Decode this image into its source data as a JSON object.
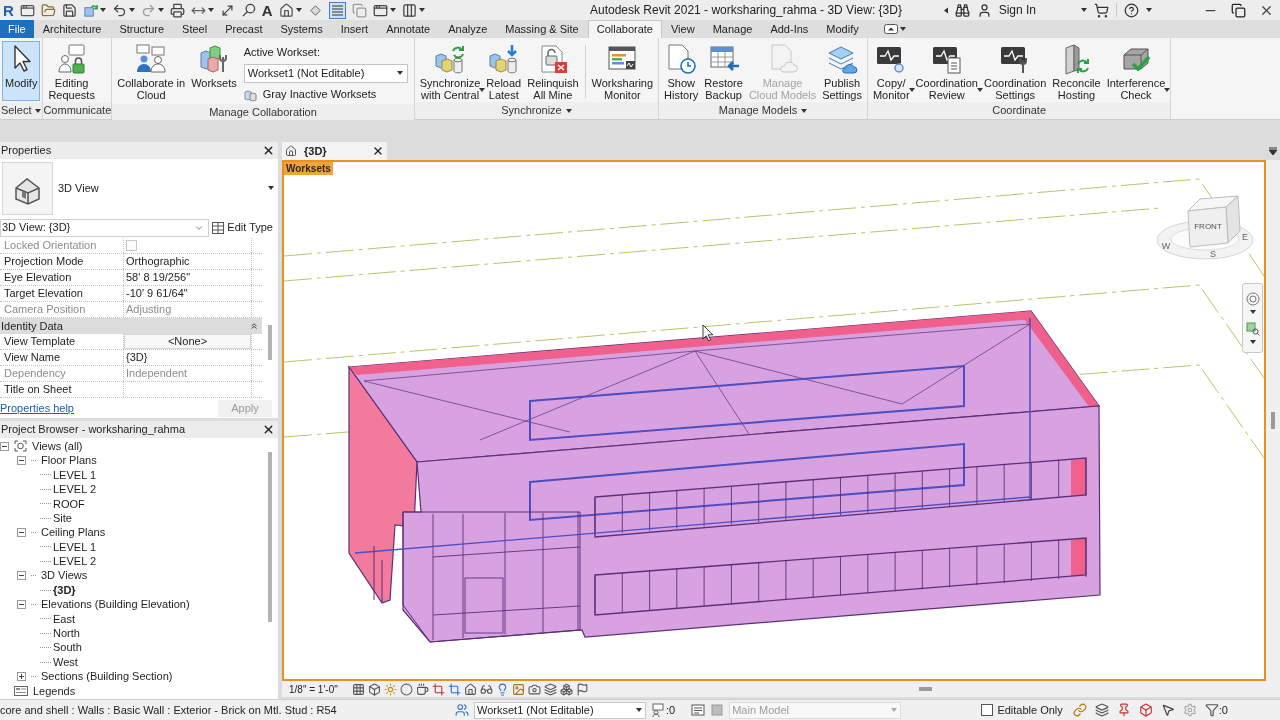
{
  "title_bar": {
    "logo": "R",
    "text_tool": "A",
    "thin_lines_active": true,
    "title": "Autodesk Revit 2021 - worksharing_rahma - 3D View: {3D}",
    "sign_in": "Sign In"
  },
  "ribbon": {
    "tabs": [
      {
        "label": "File",
        "kind": "file",
        "selected": false
      },
      {
        "label": "Architecture",
        "kind": "tab",
        "selected": false
      },
      {
        "label": "Structure",
        "kind": "tab",
        "selected": false
      },
      {
        "label": "Steel",
        "kind": "tab",
        "selected": false
      },
      {
        "label": "Precast",
        "kind": "tab",
        "selected": false
      },
      {
        "label": "Systems",
        "kind": "tab",
        "selected": false
      },
      {
        "label": "Insert",
        "kind": "tab",
        "selected": false
      },
      {
        "label": "Annotate",
        "kind": "tab",
        "selected": false
      },
      {
        "label": "Analyze",
        "kind": "tab",
        "selected": false
      },
      {
        "label": "Massing & Site",
        "kind": "tab",
        "selected": false
      },
      {
        "label": "Collaborate",
        "kind": "tab",
        "selected": true
      },
      {
        "label": "View",
        "kind": "tab",
        "selected": false
      },
      {
        "label": "Manage",
        "kind": "tab",
        "selected": false
      },
      {
        "label": "Add-Ins",
        "kind": "tab",
        "selected": false
      },
      {
        "label": "Modify",
        "kind": "tab",
        "selected": false
      }
    ],
    "panels": [
      {
        "title": "Select",
        "menu": true,
        "groups": [
          [
            {
              "label": "Modify",
              "active": true,
              "disabled": false,
              "dropdown": false
            }
          ]
        ]
      },
      {
        "title": "Communicate",
        "menu": false,
        "groups": [
          [
            {
              "label": "Editing\nRequests",
              "active": false,
              "disabled": false,
              "dropdown": false
            }
          ]
        ]
      },
      {
        "title": "Manage Collaboration",
        "menu": false,
        "groups": [
          [
            {
              "label": "Collaborate in\nCloud",
              "active": false,
              "disabled": false,
              "dropdown": false
            },
            {
              "label": "Worksets",
              "active": false,
              "disabled": false,
              "dropdown": false
            }
          ]
        ],
        "active_workset": {
          "label": "Active Workset:",
          "value": "Workset1 (Not Editable)",
          "button": "Gray Inactive Worksets"
        }
      },
      {
        "title": "Synchronize",
        "menu": true,
        "groups": [
          [
            {
              "label": "Synchronize\nwith Central",
              "active": false,
              "disabled": false,
              "dropdown": true
            },
            {
              "label": "Reload\nLatest",
              "active": false,
              "disabled": false,
              "dropdown": false
            },
            {
              "label": "Relinquish\nAll Mine",
              "active": false,
              "disabled": false,
              "dropdown": false
            }
          ],
          [
            {
              "label": "Worksharing\nMonitor",
              "active": false,
              "disabled": false,
              "dropdown": false
            }
          ]
        ]
      },
      {
        "title": "Manage Models",
        "menu": true,
        "groups": [
          [
            {
              "label": "Show\nHistory",
              "active": false,
              "disabled": false,
              "dropdown": false
            },
            {
              "label": "Restore\nBackup",
              "active": false,
              "disabled": false,
              "dropdown": false
            },
            {
              "label": "Manage\nCloud Models",
              "active": false,
              "disabled": true,
              "dropdown": false
            },
            {
              "label": "Publish\nSettings",
              "active": false,
              "disabled": false,
              "dropdown": false
            }
          ]
        ]
      },
      {
        "title": "Coordinate",
        "menu": false,
        "groups": [
          [
            {
              "label": "Copy/\nMonitor",
              "active": false,
              "disabled": false,
              "dropdown": true
            },
            {
              "label": "Coordination\nReview",
              "active": false,
              "disabled": false,
              "dropdown": true
            },
            {
              "label": "Coordination\nSettings",
              "active": false,
              "disabled": false,
              "dropdown": false
            },
            {
              "label": "Reconcile\nHosting",
              "active": false,
              "disabled": false,
              "dropdown": false
            },
            {
              "label": "Interference\nCheck",
              "active": false,
              "disabled": false,
              "dropdown": true
            }
          ]
        ]
      }
    ]
  },
  "properties": {
    "title": "Properties",
    "type_name": "3D View",
    "instance": "3D View: {3D}",
    "edit_type": "Edit Type",
    "rows": [
      {
        "kind": "checkbox",
        "name": "Locked Orientation",
        "checked": false,
        "disabled": true
      },
      {
        "kind": "param",
        "name": "Projection Mode",
        "value": "Orthographic",
        "disabled": false
      },
      {
        "kind": "param",
        "name": "Eye Elevation",
        "value": "58' 8 19/256\"",
        "disabled": false
      },
      {
        "kind": "param",
        "name": "Target Elevation",
        "value": "-10' 9 61/64\"",
        "disabled": false
      },
      {
        "kind": "param",
        "name": "Camera Position",
        "value": "Adjusting",
        "disabled": true
      },
      {
        "kind": "group",
        "name": "Identity Data",
        "expanded": true
      },
      {
        "kind": "button",
        "name": "View Template",
        "value": "<None>",
        "disabled": false
      },
      {
        "kind": "param",
        "name": "View Name",
        "value": "{3D}",
        "disabled": false
      },
      {
        "kind": "param",
        "name": "Dependency",
        "value": "Independent",
        "disabled": true
      },
      {
        "kind": "param",
        "name": "Title on Sheet",
        "disabled": false
      }
    ],
    "help_link": "Properties help",
    "apply": {
      "label": "Apply",
      "disabled": true
    }
  },
  "project_browser": {
    "title": "Project Browser - worksharing_rahma",
    "tree": [
      {
        "label": "Views (all)",
        "kind": "views",
        "expanded": true,
        "children": [
          {
            "label": "Floor Plans",
            "expanded": true,
            "children": [
              {
                "label": "LEVEL 1",
                "open": false
              },
              {
                "label": "LEVEL 2",
                "open": false
              },
              {
                "label": "ROOF",
                "open": false
              },
              {
                "label": "Site",
                "open": false
              }
            ]
          },
          {
            "label": "Ceiling Plans",
            "expanded": true,
            "children": [
              {
                "label": "LEVEL 1",
                "open": false
              },
              {
                "label": "LEVEL 2",
                "open": false
              }
            ]
          },
          {
            "label": "3D Views",
            "expanded": true,
            "children": [
              {
                "label": "{3D}",
                "open": true
              }
            ]
          },
          {
            "label": "Elevations (Building Elevation)",
            "expanded": true,
            "children": [
              {
                "label": "East",
                "open": false
              },
              {
                "label": "North",
                "open": false
              },
              {
                "label": "South",
                "open": false
              },
              {
                "label": "West",
                "open": false
              }
            ]
          },
          {
            "label": "Sections (Building Section)",
            "expanded": false
          }
        ]
      },
      {
        "label": "Legends",
        "kind": "legends"
      }
    ]
  },
  "view": {
    "tab": "{3D}",
    "worksets_label": "Worksets",
    "view_cube": {
      "face": "FRONT",
      "compass": [
        "W",
        "S",
        "E"
      ]
    },
    "scale": "1/8\" = 1'-0\""
  },
  "status_bar": {
    "message": "core and shell : Walls : Basic Wall : Exterior - Brick on Mtl. Stud : R54",
    "workset": "Workset1 (Not Editable)",
    "editing_requests": ":0",
    "design_option": {
      "value": "Main Model",
      "disabled": true
    },
    "editable_only": {
      "label": "Editable Only",
      "checked": false
    },
    "filter_count": ":0"
  }
}
